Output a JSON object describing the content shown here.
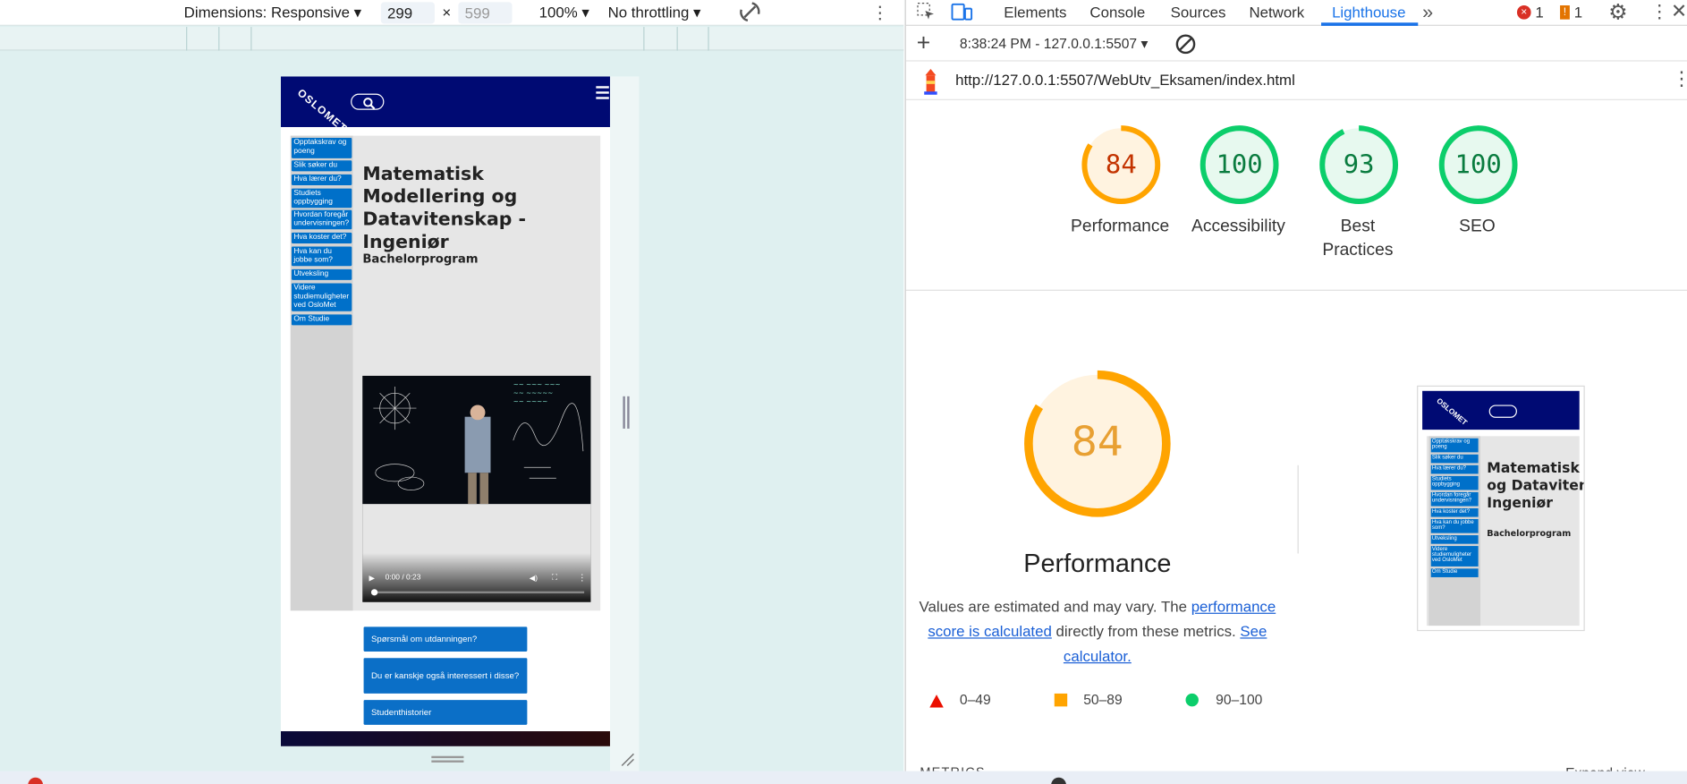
{
  "device_toolbar": {
    "dimensions_label": "Dimensions: Responsive",
    "width_value": "299",
    "height_value": "599",
    "times": "×",
    "zoom": "100%",
    "throttling": "No throttling"
  },
  "site": {
    "logo_text": "OSLOMET",
    "nav_items": [
      "Opptakskrav og poeng",
      "Slik søker du",
      "Hva lærer du?",
      "Studiets oppbygging",
      "Hvordan foregår undervisningen?",
      "Hva koster det?",
      "Hva kan du jobbe som?",
      "Utveksling",
      "Videre studiemuligheter ved OsloMet",
      "Om Studie"
    ],
    "title": "Matematisk Modellering og Datavitenskap - Ingeniør",
    "subtitle": "Bachelorprogram",
    "video_time": "0:00 / 0:23",
    "buttons": [
      "Spørsmål om utdanningen?",
      "Du er kanskje også interessert i disse?",
      "Studenthistorier"
    ]
  },
  "devtools": {
    "tabs": [
      "Elements",
      "Console",
      "Sources",
      "Network",
      "Lighthouse"
    ],
    "active_tab": "Lighthouse",
    "error_count": "1",
    "warning_count": "1",
    "report_time": "8:38:24 PM - 127.0.0.1:5507",
    "url": "http://127.0.0.1:5507/WebUtv_Eksamen/index.html",
    "scores": [
      {
        "label": "Performance",
        "value": 84
      },
      {
        "label": "Accessibility",
        "value": 100
      },
      {
        "label": "Best Practices",
        "value": 93
      },
      {
        "label": "SEO",
        "value": 100
      }
    ],
    "score_label_practices_1": "Best",
    "score_label_practices_2": "Practices",
    "perf_score": 84,
    "perf_title": "Performance",
    "perf_note_1": "Values are estimated and may vary. The",
    "perf_link_1a": "performance",
    "perf_link_1b": "score is calculated",
    "perf_note_2": "directly from these metrics.",
    "perf_link_2a": "See",
    "perf_link_2b": "calculator.",
    "legend": [
      "0–49",
      "50–89",
      "90–100"
    ],
    "metrics_heading": "METRICS",
    "expand_view": "Expand view",
    "thumb_title": "Matematisk Modellering og Datavitenskap - Ingeniør",
    "thumb_title_lines": [
      "Matematisk M",
      "og Datavitens",
      "Ingeniør"
    ],
    "thumb_subtitle": "Bachelorprogram",
    "thumb_nav": [
      "Opptakskrav og poeng",
      "Slik søker du",
      "Hva lærer du?",
      "Studiets oppbygging",
      "Hvordan foregår undervisningen?",
      "Hva koster det?",
      "Hva kan du jobbe som?",
      "Utveksling",
      "Videre studiemuligheter ved OsloMet",
      "Om Studie"
    ]
  },
  "colors": {
    "site_header": "#000a73",
    "nav_blue": "#0070c9",
    "average": "#ffa400",
    "pass": "#0cce6b",
    "fail": "#ff4e42"
  }
}
